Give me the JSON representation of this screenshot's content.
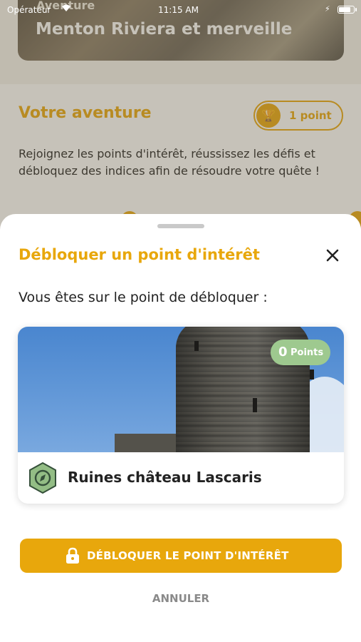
{
  "status_bar": {
    "carrier": "Opérateur",
    "time": "11:15 AM"
  },
  "background": {
    "hero": {
      "kicker": "Aventure",
      "title": "Menton Riviera et merveille"
    },
    "adventure": {
      "title": "Votre aventure",
      "points_label": "1 point",
      "description": "Rejoignez les points d'intérêt, réussissez les défis et débloquez des indices afin de résoudre votre quête !"
    }
  },
  "sheet": {
    "title": "Débloquer un point d'intérêt",
    "subtitle": "Vous êtes sur le point de débloquer :",
    "poi": {
      "points_value": "0",
      "points_label": "Points",
      "name": "Ruines château Lascaris"
    },
    "unlock_button": "DÉBLOQUER LE POINT D'INTÉRÊT",
    "cancel_button": "ANNULER"
  },
  "colors": {
    "accent": "#e8a70c",
    "badge_green": "#9ec98f",
    "text": "#222222",
    "muted": "#8a8a8a"
  },
  "icons": [
    "wifi-icon",
    "charging-bolt-icon",
    "battery-icon",
    "trophy-icon",
    "close-icon",
    "compass-icon",
    "lock-icon"
  ]
}
